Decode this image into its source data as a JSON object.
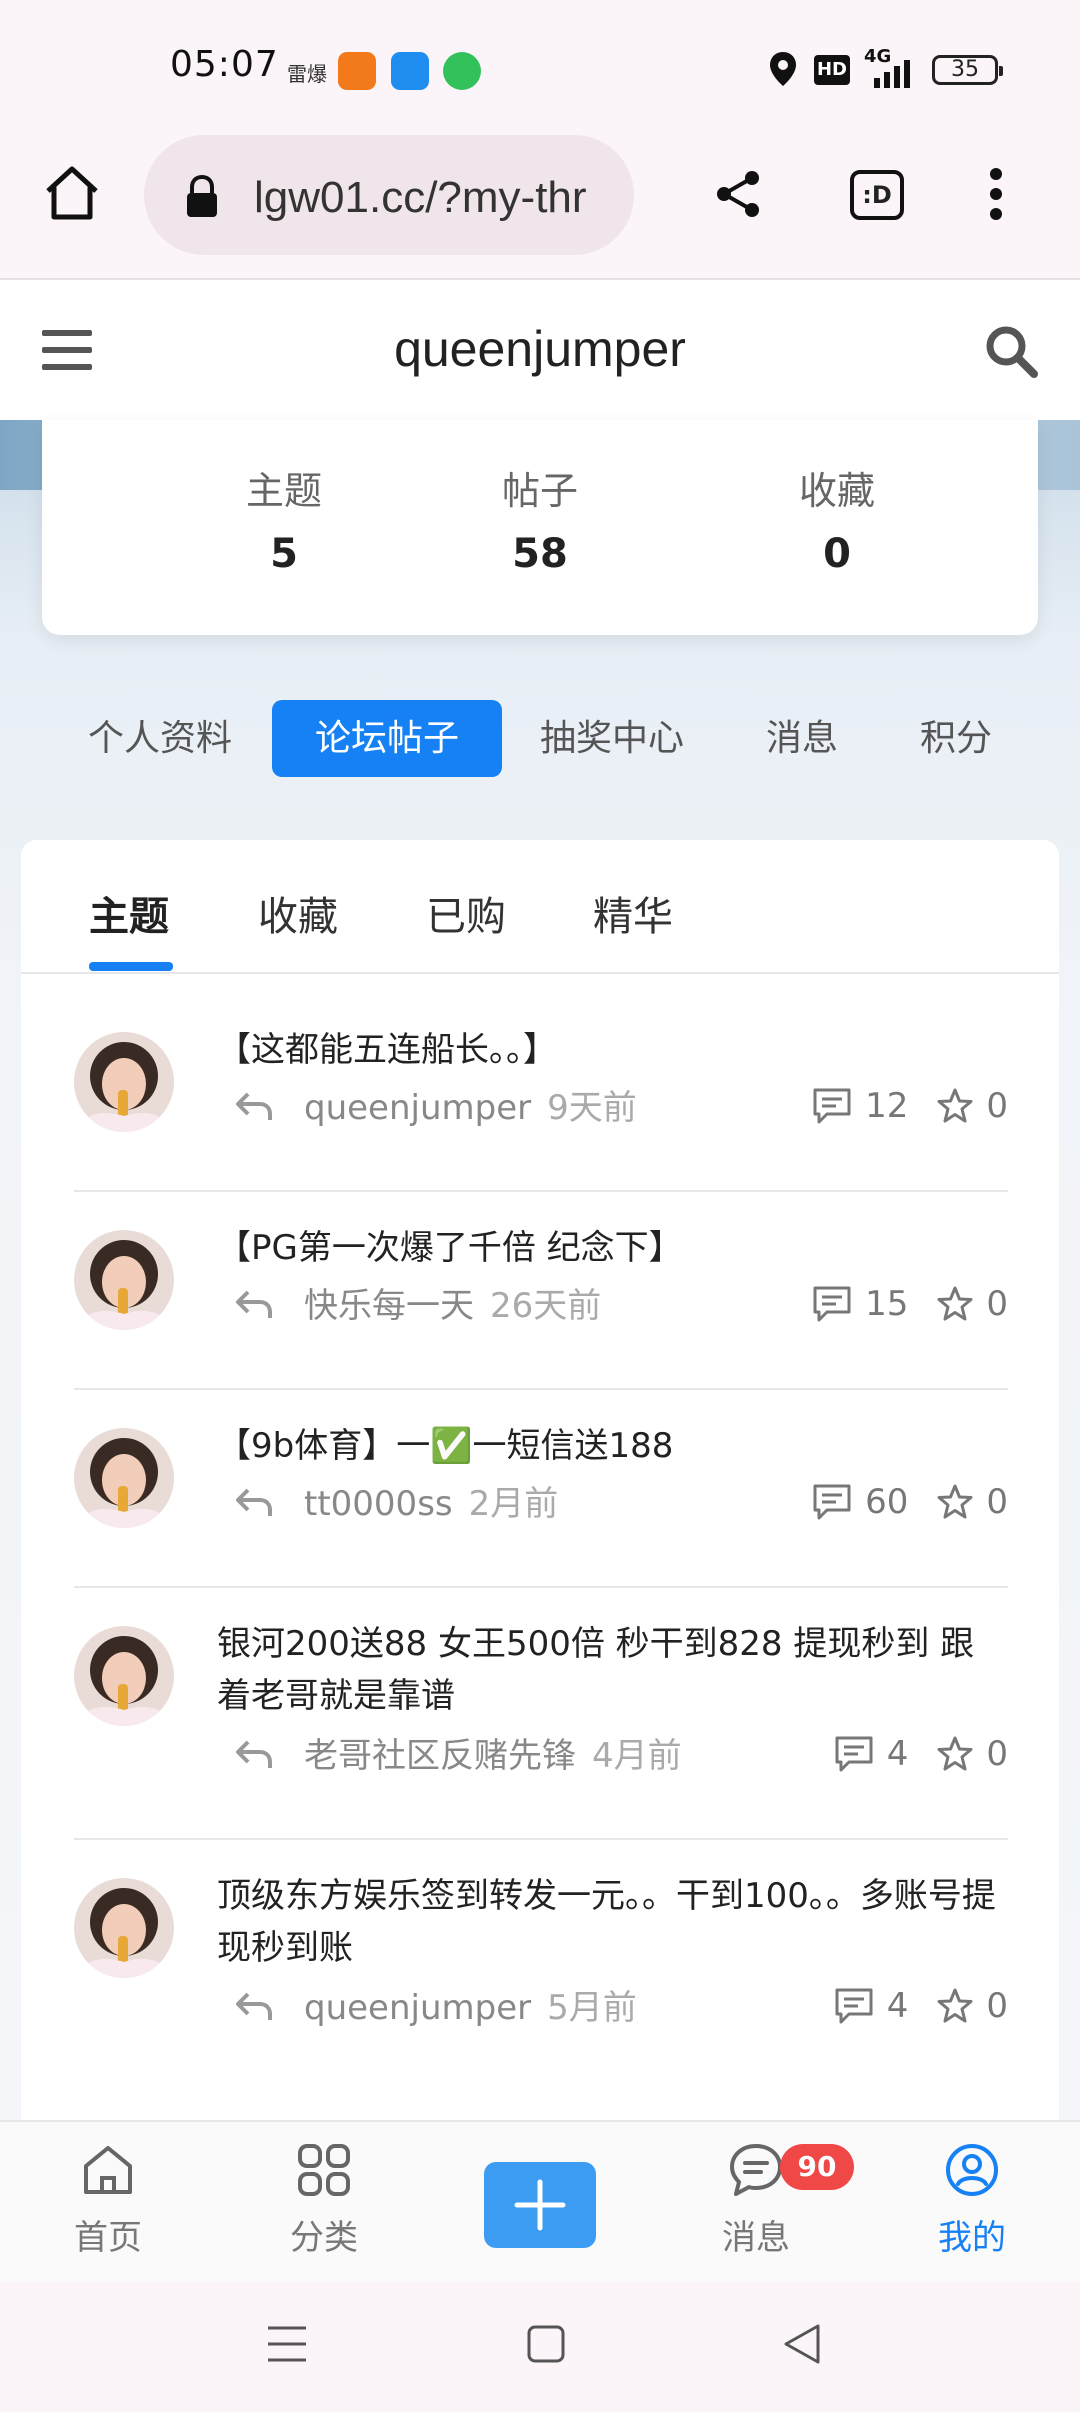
{
  "status_bar": {
    "time": "05:07",
    "carrier_icon_text": "雷爆",
    "signal": "4G",
    "hd": "HD",
    "battery": "35"
  },
  "browser": {
    "url": "lgw01.cc/?my-thr",
    "icons": [
      "home-icon",
      "lock-icon",
      "share-icon",
      "tab-switch-icon",
      "more-vert-icon"
    ],
    "tab_icon_text": ":D"
  },
  "header": {
    "title": "queenjumper",
    "icons": [
      "menu-icon",
      "search-icon"
    ]
  },
  "stats": [
    {
      "label": "主题",
      "value": "5"
    },
    {
      "label": "帖子",
      "value": "58"
    },
    {
      "label": "收藏",
      "value": "0"
    }
  ],
  "profile_tabs": [
    {
      "label": "个人资料",
      "active": false
    },
    {
      "label": "论坛帖子",
      "active": true
    },
    {
      "label": "抽奖中心",
      "active": false
    },
    {
      "label": "消息",
      "active": false
    },
    {
      "label": "积分",
      "active": false
    }
  ],
  "sub_tabs": [
    {
      "label": "主题",
      "active": true
    },
    {
      "label": "收藏",
      "active": false
    },
    {
      "label": "已购",
      "active": false
    },
    {
      "label": "精华",
      "active": false
    }
  ],
  "posts": [
    {
      "title": "【这都能五连船长。。】",
      "author": "queenjumper",
      "time": "9天前",
      "replies": "12",
      "favorites": "0"
    },
    {
      "title": "【PG第一次爆了千倍 纪念下】",
      "author": "快乐每一天",
      "time": "26天前",
      "replies": "15",
      "favorites": "0"
    },
    {
      "title": "【9b体育】一✅一短信送188",
      "author": "tt0000ss",
      "time": "2月前",
      "replies": "60",
      "favorites": "0"
    },
    {
      "title": "银河200送88 女王500倍 秒干到828 提现秒到 跟着老哥就是靠谱",
      "author": "老哥社区反赌先锋",
      "time": "4月前",
      "replies": "4",
      "favorites": "0"
    },
    {
      "title": "顶级东方娱乐签到转发一元。。干到100。。多账号提现秒到账",
      "author": "queenjumper",
      "time": "5月前",
      "replies": "4",
      "favorites": "0"
    }
  ],
  "bottom_nav": [
    {
      "label": "首页",
      "icon": "home-icon"
    },
    {
      "label": "分类",
      "icon": "grid-icon"
    },
    {
      "label": "",
      "icon": "plus-icon"
    },
    {
      "label": "消息",
      "icon": "chat-icon",
      "badge": "90"
    },
    {
      "label": "我的",
      "icon": "user-circle-icon",
      "active": true
    }
  ],
  "colors": {
    "accent": "#1681f5",
    "badge": "#f04747",
    "add_button": "#3b9cf2"
  }
}
